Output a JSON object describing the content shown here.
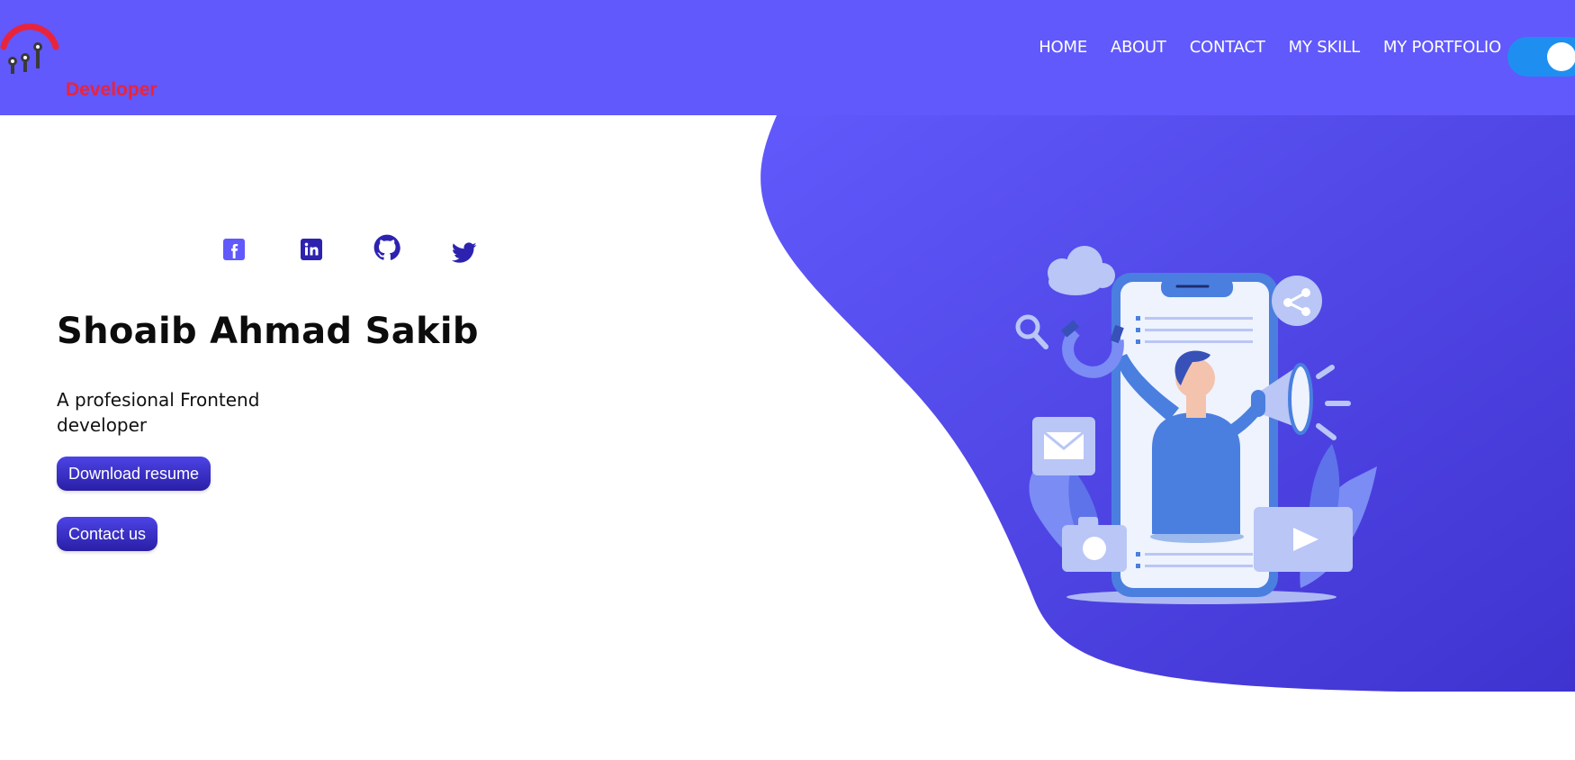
{
  "brand": {
    "name": "Developer"
  },
  "nav": {
    "links": [
      "HOME",
      "ABOUT",
      "CONTACT",
      "MY SKILL",
      "MY PORTFOLIO"
    ]
  },
  "hero": {
    "name": "Shoaib Ahmad Sakib",
    "tagline": "A profesional Frontend developer",
    "buttons": {
      "download": "Download resume",
      "contact": "Contact us"
    }
  },
  "socials": [
    "facebook-icon",
    "linkedin-icon",
    "github-icon",
    "twitter-icon"
  ],
  "theme": {
    "primary": "#6159fb",
    "toggle": "#1e8ff0",
    "brand_text": "#e8243d",
    "button_dark": "#2a1fa6"
  }
}
